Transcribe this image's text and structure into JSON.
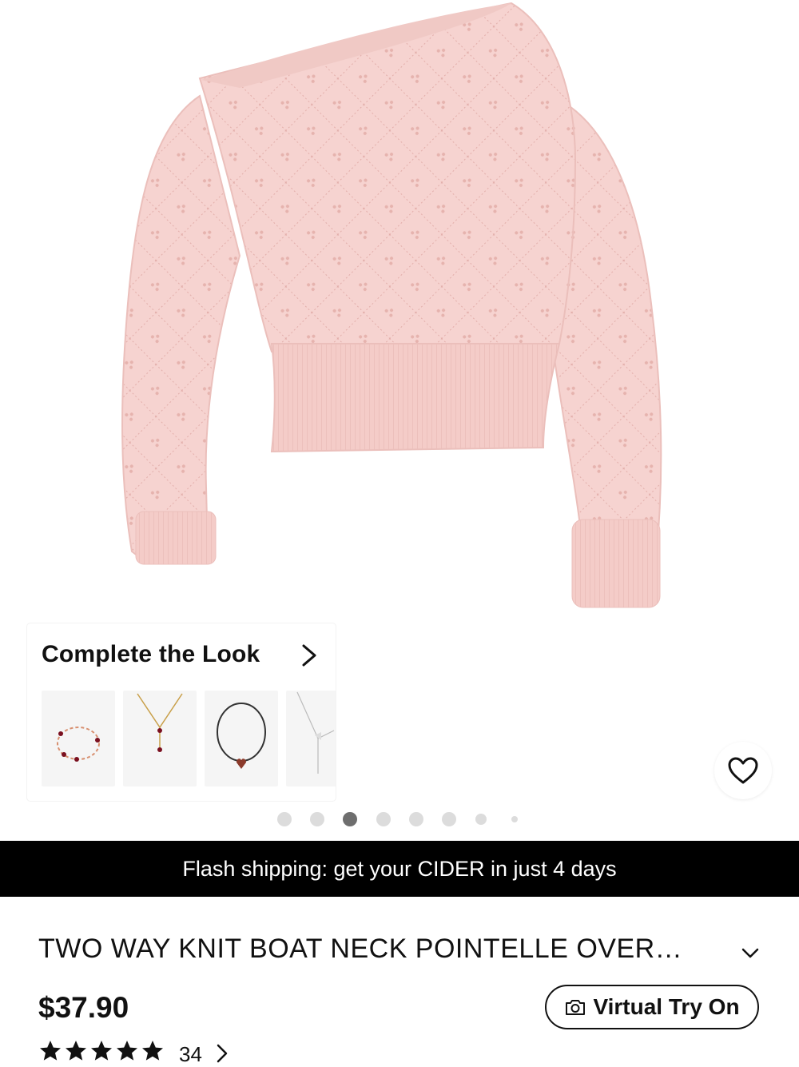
{
  "product_image": {
    "alt": "pink pointelle knit sweater"
  },
  "complete_look": {
    "title": "Complete the Look",
    "items": [
      {
        "name": "heart-bracelet"
      },
      {
        "name": "heart-necklace-gold"
      },
      {
        "name": "heart-choker"
      },
      {
        "name": "bow-necklace"
      }
    ]
  },
  "carousel": {
    "total": 8,
    "active_index": 2
  },
  "banner": {
    "text": "Flash shipping: get your CIDER in just 4 days"
  },
  "product": {
    "title": "TWO WAY KNIT BOAT NECK POINTELLE OVER…",
    "price": "$37.90",
    "rating_count": "34",
    "stars": 5
  },
  "actions": {
    "virtual_try_on": "Virtual Try On"
  },
  "colors": {
    "sweater": "#f6d3d0",
    "sweater_shadow": "#ebbfbb",
    "banner_bg": "#000000",
    "text": "#111111"
  }
}
